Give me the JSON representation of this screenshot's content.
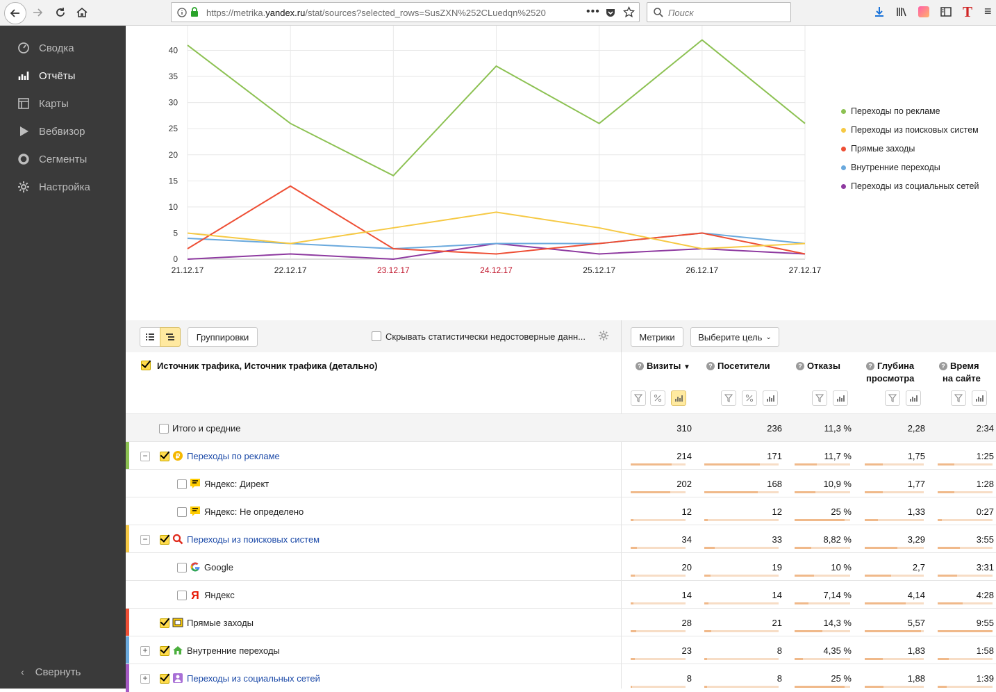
{
  "browser": {
    "url_prefix": "https://metrika.",
    "url_host": "yandex.ru",
    "url_rest": "/stat/sources?selected_rows=SusZXN%252CLuedqn%2520",
    "search_placeholder": "Поиск"
  },
  "sidebar": {
    "items": [
      {
        "label": "Сводка",
        "icon": "gauge-icon"
      },
      {
        "label": "Отчёты",
        "icon": "bar-chart-icon",
        "active": true
      },
      {
        "label": "Карты",
        "icon": "map-grid-icon"
      },
      {
        "label": "Вебвизор",
        "icon": "play-icon"
      },
      {
        "label": "Сегменты",
        "icon": "pie-segment-icon"
      },
      {
        "label": "Настройка",
        "icon": "gear-icon"
      }
    ],
    "collapse_label": "Свернуть"
  },
  "chart_data": {
    "type": "line",
    "x": [
      "21.12.17",
      "22.12.17",
      "23.12.17",
      "24.12.17",
      "25.12.17",
      "26.12.17",
      "27.12.17"
    ],
    "weekend_x": [
      "23.12.17",
      "24.12.17"
    ],
    "ylim": [
      0,
      45
    ],
    "yticks": [
      0,
      5,
      10,
      15,
      20,
      25,
      30,
      35,
      40
    ],
    "grid": true,
    "legend": "right",
    "series": [
      {
        "name": "Переходы по рекламе",
        "color": "#8cc152",
        "values": [
          41,
          26,
          16,
          37,
          26,
          42,
          26
        ]
      },
      {
        "name": "Переходы из поисковых систем",
        "color": "#f6c944",
        "values": [
          5,
          3,
          6,
          9,
          6,
          2,
          3
        ]
      },
      {
        "name": "Прямые заходы",
        "color": "#ee4f35",
        "values": [
          2,
          14,
          2,
          1,
          3,
          5,
          1
        ]
      },
      {
        "name": "Внутренние переходы",
        "color": "#6aa9dd",
        "values": [
          4,
          3,
          2,
          3,
          3,
          5,
          3
        ]
      },
      {
        "name": "Переходы из социальных сетей",
        "color": "#8e3aa0",
        "values": [
          0,
          1,
          0,
          3,
          1,
          2,
          1
        ]
      }
    ]
  },
  "controls": {
    "groupings_label": "Группировки",
    "hide_unreliable_label": "Скрывать статистически недостоверные данн...",
    "metrics_label": "Метрики",
    "goal_label": "Выберите цель"
  },
  "table": {
    "dimension_header": "Источник трафика, Источник трафика (детально)",
    "columns": [
      {
        "title": "Визиты",
        "sort": "▼"
      },
      {
        "title": "Посетители"
      },
      {
        "title": "Отказы"
      },
      {
        "title": "Глубина",
        "title2": "просмотра"
      },
      {
        "title": "Время",
        "title2": "на сайте"
      }
    ],
    "total": {
      "label": "Итого и средние",
      "values": [
        "310",
        "236",
        "11,3 %",
        "2,28",
        "2:34"
      ]
    },
    "rows": [
      {
        "label": "Переходы по рекламе",
        "level": 0,
        "expand": "−",
        "color": "#8cc152",
        "icon": "ad-coin-icon",
        "link": true,
        "checked": true,
        "values": [
          "214",
          "171",
          "11,7 %",
          "1,75",
          "1:25"
        ],
        "bars": [
          0.75,
          0.75,
          0.4,
          0.3,
          0.3
        ]
      },
      {
        "label": "Яндекс: Директ",
        "level": 1,
        "icon": "yandex-direct-icon",
        "values": [
          "202",
          "168",
          "10,9 %",
          "1,77",
          "1:28"
        ],
        "bars": [
          0.72,
          0.72,
          0.38,
          0.3,
          0.3
        ]
      },
      {
        "label": "Яндекс: Не определено",
        "level": 1,
        "icon": "yandex-direct-icon",
        "values": [
          "12",
          "12",
          "25 %",
          "1,33",
          "0:27"
        ],
        "bars": [
          0.05,
          0.05,
          0.9,
          0.22,
          0.08
        ]
      },
      {
        "label": "Переходы из поисковых систем",
        "level": 0,
        "expand": "−",
        "color": "#f6c944",
        "icon": "search-engine-icon",
        "link": true,
        "checked": true,
        "values": [
          "34",
          "33",
          "8,82 %",
          "3,29",
          "3:55"
        ],
        "bars": [
          0.12,
          0.14,
          0.3,
          0.55,
          0.4
        ]
      },
      {
        "label": "Google",
        "level": 1,
        "icon": "google-icon",
        "values": [
          "20",
          "19",
          "10 %",
          "2,7",
          "3:31"
        ],
        "bars": [
          0.07,
          0.08,
          0.35,
          0.45,
          0.36
        ]
      },
      {
        "label": "Яндекс",
        "level": 1,
        "icon": "yandex-icon",
        "values": [
          "14",
          "14",
          "7,14 %",
          "4,14",
          "4:28"
        ],
        "bars": [
          0.05,
          0.06,
          0.25,
          0.7,
          0.45
        ]
      },
      {
        "label": "Прямые заходы",
        "level": 0,
        "color": "#ee4f35",
        "icon": "direct-visit-icon",
        "checked": true,
        "values": [
          "28",
          "21",
          "14,3 %",
          "5,57",
          "9:55"
        ],
        "bars": [
          0.1,
          0.09,
          0.5,
          0.95,
          1.0
        ]
      },
      {
        "label": "Внутренние переходы",
        "level": 0,
        "expand": "+",
        "color": "#6aa9dd",
        "icon": "home-icon",
        "checked": true,
        "values": [
          "23",
          "8",
          "4,35 %",
          "1,83",
          "1:58"
        ],
        "bars": [
          0.08,
          0.04,
          0.15,
          0.31,
          0.2
        ]
      },
      {
        "label": "Переходы из социальных сетей",
        "level": 0,
        "expand": "+",
        "color": "#a45ac3",
        "icon": "social-icon",
        "link": true,
        "checked": true,
        "values": [
          "8",
          "8",
          "25 %",
          "1,88",
          "1:39"
        ],
        "bars": [
          0.03,
          0.04,
          0.9,
          0.32,
          0.17
        ]
      }
    ]
  }
}
